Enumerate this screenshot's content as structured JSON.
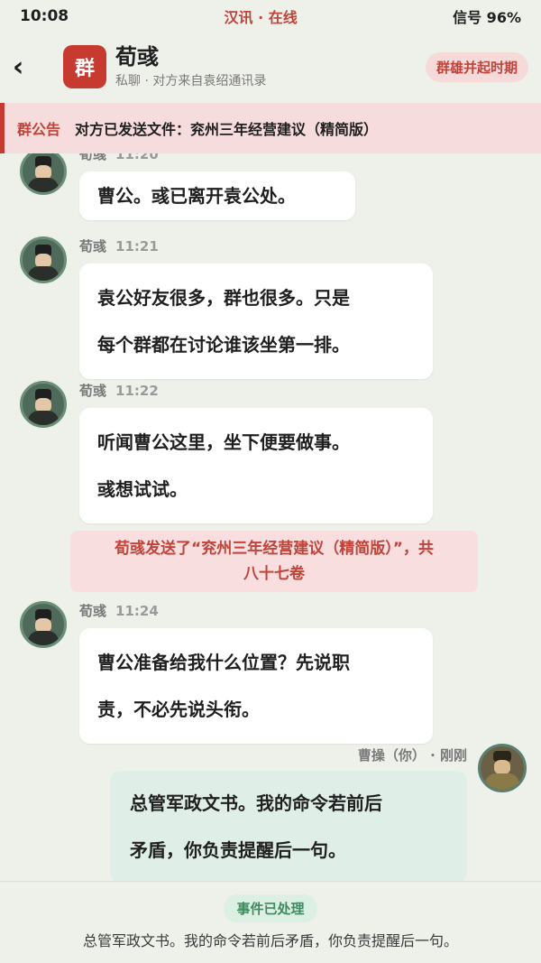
{
  "status_bar": {
    "time": "10:08",
    "center": "汉讯 · 在线",
    "right": "信号 96%"
  },
  "header": {
    "back_icon": "chevron-left-icon",
    "badge": "群",
    "title": "荀彧",
    "subtitle": "私聊 · 对方来自袁绍通讯录",
    "era": "群雄并起时期"
  },
  "notice": {
    "label": "群公告",
    "text": "对方已发送文件：兖州三年经营建议（精简版）"
  },
  "messages": [
    {
      "sender": "荀彧",
      "time": "11:20",
      "text": "曹公。彧已离开袁公处。"
    },
    {
      "sender": "荀彧",
      "time": "11:21",
      "lines": [
        "袁公好友很多，群也很多。只是",
        "每个群都在讨论谁该坐第一排。"
      ]
    },
    {
      "sender": "荀彧",
      "time": "11:22",
      "lines": [
        "听闻曹公这里，坐下便要做事。",
        "彧想试试。"
      ]
    },
    {
      "system_lines": [
        "荀彧发送了“兖州三年经营建议（精简版）”，共",
        "八十七卷"
      ]
    },
    {
      "sender": "荀彧",
      "time": "11:24",
      "lines": [
        "曹公准备给我什么位置？先说职",
        "责，不必先说头衔。"
      ]
    }
  ],
  "self_message": {
    "meta": "曹操（你） · 刚刚",
    "lines": [
      "总管军政文书。我的命令若前后",
      "矛盾，你负责提醒后一句。"
    ]
  },
  "footer": {
    "badge": "事件已处理",
    "text": "总管军政文书。我的命令若前后矛盾，你负责提醒后一句。"
  },
  "colors": {
    "accent": "#c73a2f",
    "background": "#eef0ea",
    "self_bubble": "#dfeee6"
  }
}
